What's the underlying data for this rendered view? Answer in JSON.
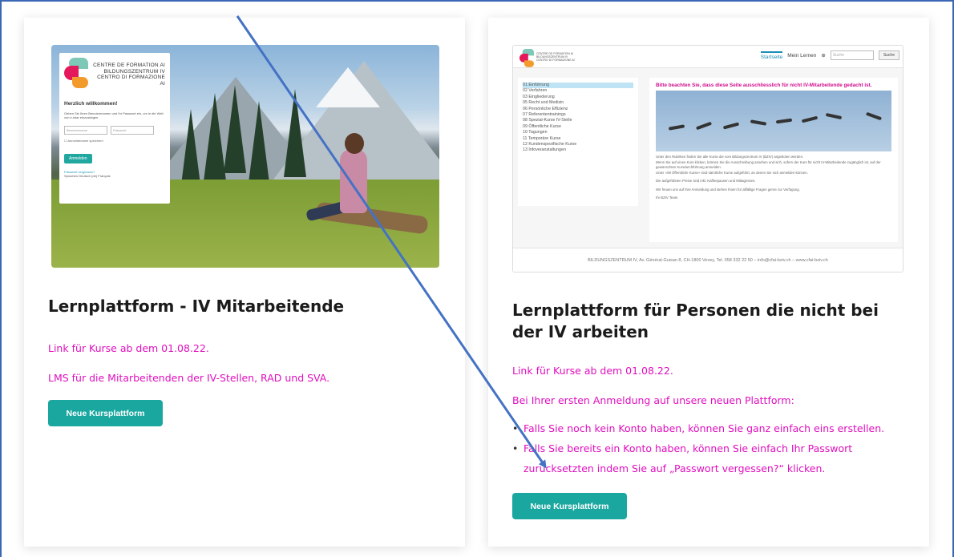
{
  "left_card": {
    "login_preview": {
      "logo_lines": [
        "CENTRE DE FORMATION AI",
        "BILDUNGSZENTRUM IV",
        "CENTRO DI FORMAZIONE AI"
      ],
      "welcome": "Herzlich willkommen!",
      "intro": "Geben Sie Ihren Benutzernamen und Ihr Passwort ein, um in die Welt von e-lstar einzusteigen.",
      "username_placeholder": "Benutzername",
      "password_placeholder": "Passwort",
      "remember": "Anmeldename speichern",
      "login_button": "Anmelden",
      "forgot": "Passwort vergessen?",
      "languages": "Sprachen Deutsch ‎(de)‎ Français"
    },
    "title": "Lernplattform - IV Mitarbeitende",
    "link_text": "Link für Kurse ab dem 01.08.22.",
    "description": "LMS für die Mitarbeitenden der IV-Stellen, RAD und SVA.",
    "button": "Neue Kursplattform"
  },
  "right_card": {
    "site_preview": {
      "logo_lines": [
        "CENTRE DE FORMATION AI",
        "BILDUNGSZENTRUM IV",
        "CENTRO DI FORMAZIONE AI"
      ],
      "nav": [
        "Startseite",
        "Mein Lernen"
      ],
      "search_placeholder": "Suche",
      "search_button": "Suche",
      "menu": [
        "01 Einführung",
        "02 Verfahren",
        "03 Eingliederung",
        "05 Recht und Medizin",
        "06 Persönliche Effizienz",
        "07 Referententrainings",
        "08 Spezial-Kurse IV-Stelle",
        "09 Öffentliche Kurse",
        "10 Tagungen",
        "11 Temporäre Kurse",
        "12 Kundenspezifische Kurse",
        "13 Infoveranstaltungen"
      ],
      "warning": "Bitte beachten Sie, dass diese Seite ausschliesslich für nicht IV-Mitarbeitende gedacht ist.",
      "paragraphs": [
        "Unter den Rubriken finden Sie alle Kurse die vom Bildungszentrum IV (BZIV) angeboten werden.",
        "Wenn Sie auf einen Kurs klicken, können Sie die Ausschreibung ansehen und sich, sofern der Kurs für nicht IV-Mitarbeitende zugänglich ist, auf der gewünschten Kursdurchführung anmelden.",
        "Unter «09 Öffentliche Kurse» sind sämtliche Kurse aufgeführt, an denen Sie sich anmelden können.",
        "Die aufgeführten Preise sind inkl. Kaffeepausen und Mittagessen.",
        "Wir freuen uns auf Ihre Anmeldung und stehen Ihnen für allfällige Fragen gerne zur Verfügung.",
        "Ihr BZIV Team"
      ],
      "footer": "BILDUNGSZENTRUM IV, Av. Général-Guisan 8, CH-1800 Vevey, Tel. 058 332 22 50 – info@cfai-bziv.ch – www.cfai-bziv.ch"
    },
    "title": "Lernplattform für Personen die nicht bei der IV arbeiten",
    "link_text": "Link für Kurse ab dem 01.08.22.",
    "intro": "Bei Ihrer ersten Anmeldung auf unsere neuen Plattform:",
    "bullets": [
      "Falls Sie noch kein Konto haben, können Sie ganz einfach eins erstellen.",
      "Falls Sie bereits ein Konto haben, können Sie einfach Ihr Passwort zurücksetzten indem Sie auf „Passwort vergessen?“ klicken."
    ],
    "button": "Neue Kursplattform"
  },
  "colors": {
    "teal": "#1aa7a0",
    "magenta": "#e00fbf",
    "frame_blue": "#3a68b4",
    "arrow_blue": "#4472c4"
  }
}
